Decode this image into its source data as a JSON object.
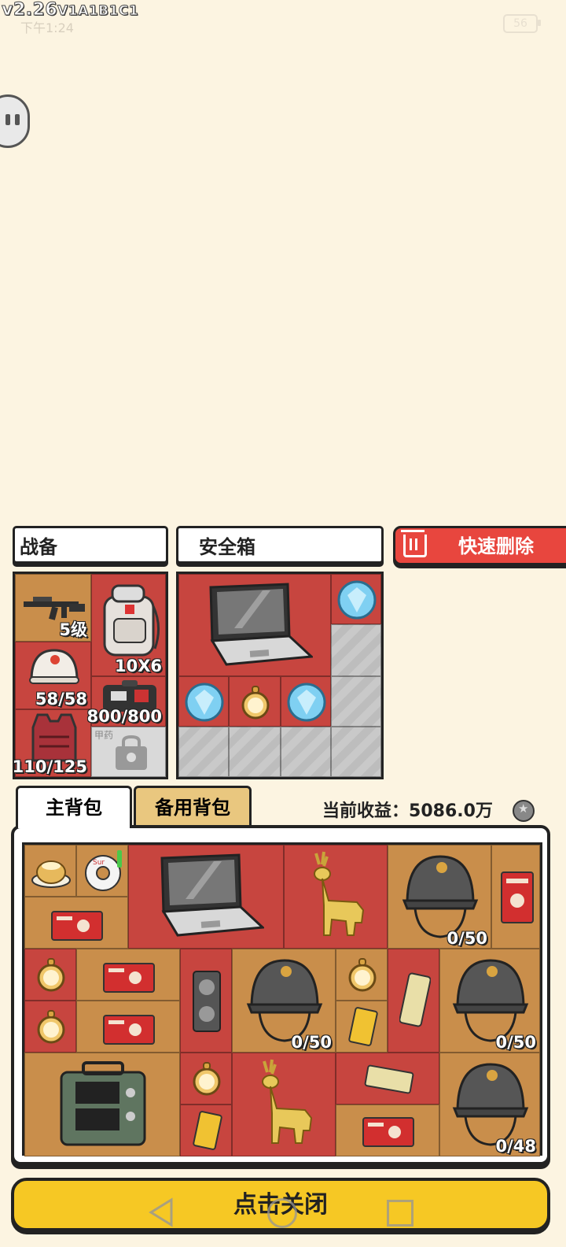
{
  "status_bar": {
    "version_main": "v2.26",
    "version_build": "V1A1B1C1",
    "clock": "下午1:24",
    "battery": "56"
  },
  "equipment": {
    "title": "战备",
    "weapon_level": "5级",
    "backpack_size": "10X6",
    "helmet_durability": "58/58",
    "armor_durability": "110/125",
    "supply_capacity": "800/800",
    "locked_slot_label": "甲药"
  },
  "safe_box": {
    "title": "安全箱"
  },
  "quick_delete_label": "快速删除",
  "tabs": {
    "main": "主背包",
    "backup": "备用背包"
  },
  "income": {
    "label": "当前收益：",
    "value": "5086.0万"
  },
  "inventory_labels": {
    "helmet_top": "0/50",
    "helmet_mid": "0/50",
    "helmet_right": "0/50",
    "helmet_bottom": "0/48"
  },
  "close_button": "点击关闭",
  "colors": {
    "background": "#fcf4e1",
    "tan_cell": "#c98e4b",
    "red_cell": "#c7453f",
    "close_button": "#f6c824",
    "delete_button": "#e8463e"
  },
  "icons": [
    "rifle-icon",
    "backpack-icon",
    "helmet-icon",
    "armor-vest-icon",
    "ammo-box-icon",
    "lock-icon",
    "laptop-icon",
    "diamond-icon",
    "pocket-watch-icon",
    "cake-icon",
    "donut-icon",
    "red-box-icon",
    "golden-deer-icon",
    "gpu-card-icon",
    "gold-bar-icon",
    "radio-icon",
    "trash-icon",
    "coin-icon",
    "pause-icon"
  ]
}
